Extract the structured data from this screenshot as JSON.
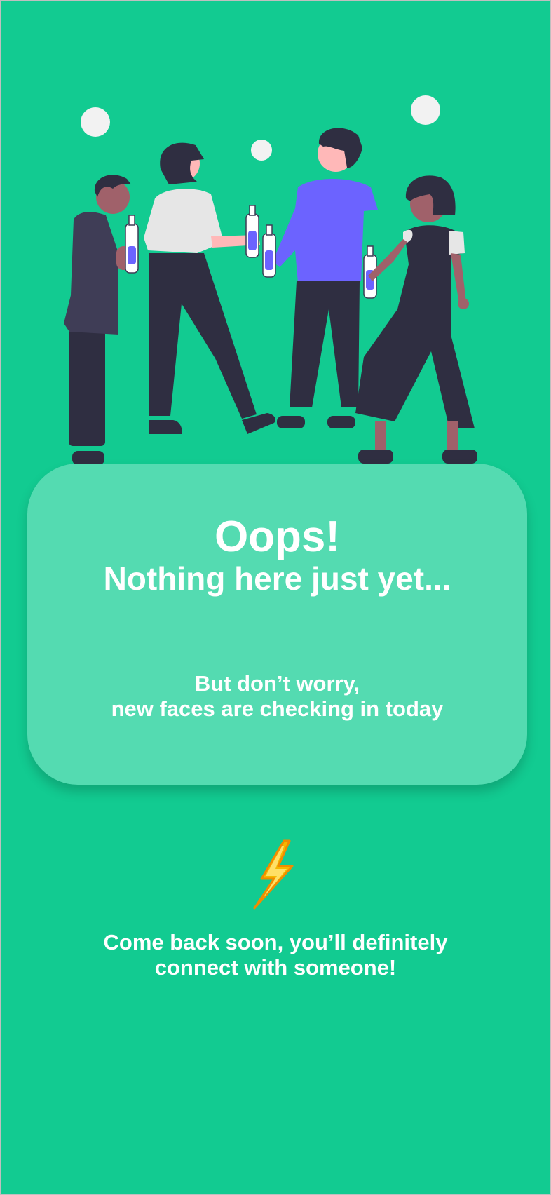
{
  "empty_state": {
    "title": "Oops!",
    "subtitle": "Nothing here just yet...",
    "message_line1": "But don’t worry,",
    "message_line2": "new faces are checking in today",
    "footer_line1": "Come back soon, you’ll definitely",
    "footer_line2": "connect with someone!"
  },
  "icons": {
    "illustration": "friends-toasting-illustration",
    "accent": "lightning-bolt-icon"
  },
  "colors": {
    "background": "#12cb91",
    "card": "#54dbb1",
    "text": "#ffffff",
    "accent_purple": "#6c63ff",
    "bolt": "#f5b800"
  }
}
